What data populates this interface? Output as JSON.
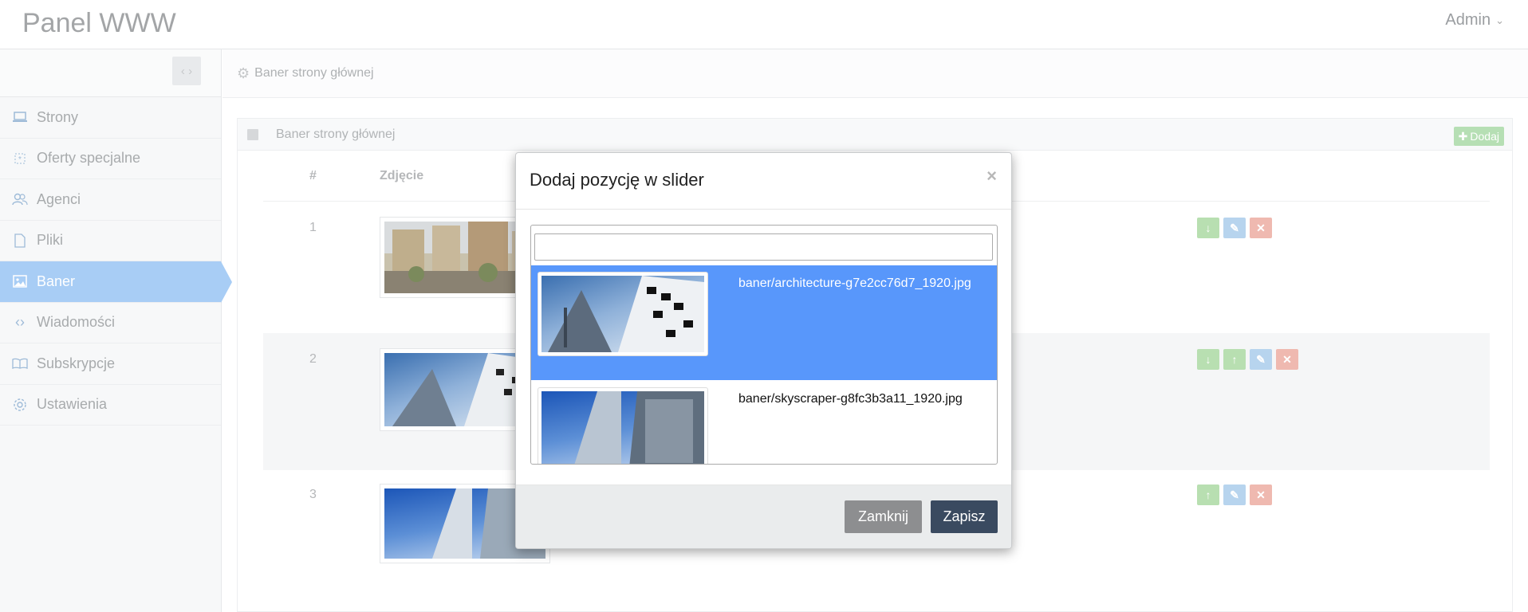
{
  "app": {
    "brand": "Panel WWW",
    "user": "Admin"
  },
  "sidebar": {
    "items": [
      {
        "label": "Strony",
        "icon": "laptop-icon"
      },
      {
        "label": "Oferty specjalne",
        "icon": "star-icon"
      },
      {
        "label": "Agenci",
        "icon": "users-icon"
      },
      {
        "label": "Pliki",
        "icon": "file-icon"
      },
      {
        "label": "Baner",
        "icon": "image-icon"
      },
      {
        "label": "Wiadomości",
        "icon": "code-icon"
      },
      {
        "label": "Subskrypcje",
        "icon": "book-icon"
      },
      {
        "label": "Ustawienia",
        "icon": "gear-icon"
      }
    ],
    "active": "Baner"
  },
  "breadcrumb": {
    "label": "Baner strony głównej"
  },
  "panel": {
    "title": "Baner strony głównej",
    "add_label": "Dodaj",
    "columns": {
      "number": "#",
      "photo": "Zdjęcie"
    },
    "rows": [
      {
        "number": "1",
        "actions": [
          "down",
          "edit",
          "delete"
        ]
      },
      {
        "number": "2",
        "actions": [
          "down",
          "up",
          "edit",
          "delete"
        ]
      },
      {
        "number": "3",
        "actions": [
          "up",
          "edit",
          "delete"
        ]
      }
    ]
  },
  "modal": {
    "title": "Dodaj pozycję w slider",
    "close_symbol": "×",
    "search": {
      "value": "",
      "placeholder": ""
    },
    "options": [
      {
        "name": "baner/architecture-g7e2cc76d7_1920.jpg",
        "selected": true
      },
      {
        "name": "baner/skyscraper-g8fc3b3a11_1920.jpg",
        "selected": false
      }
    ],
    "buttons": {
      "close": "Zamknij",
      "save": "Zapisz"
    }
  },
  "colors": {
    "sidebar_active": "#a8cdf5",
    "option_selected": "#5897fb",
    "save_button": "#3a4a60",
    "close_button": "#8d8e90"
  }
}
